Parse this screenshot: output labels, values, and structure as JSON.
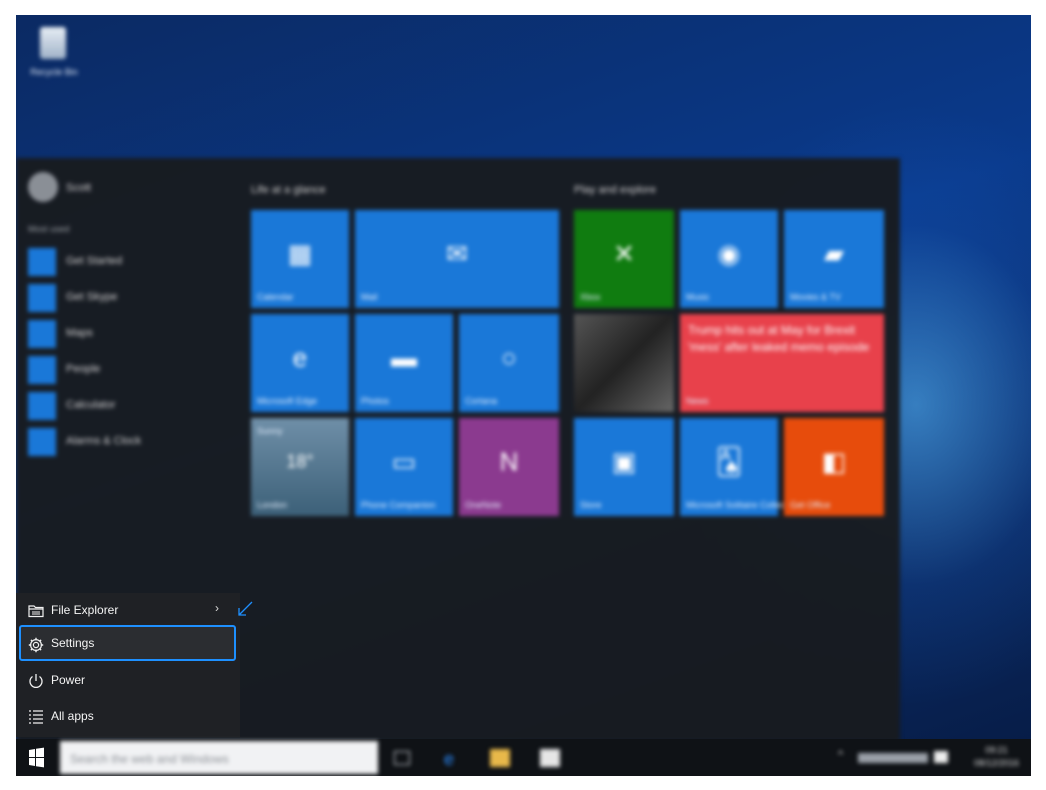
{
  "desktop": {
    "recycle_label": "Recycle Bin"
  },
  "start_menu": {
    "user_name": "Scott",
    "most_used_label": "Most used",
    "most_used": [
      {
        "label": "Get Started"
      },
      {
        "label": "Get Skype"
      },
      {
        "label": "Maps"
      },
      {
        "label": "People"
      },
      {
        "label": "Calculator"
      },
      {
        "label": "Alarms & Clock"
      }
    ],
    "group_life": "Life at a glance",
    "group_play": "Play and explore",
    "tiles": {
      "calendar": "Calendar",
      "mail": "Mail",
      "edge": "Microsoft Edge",
      "photos": "Photos",
      "cortana": "Cortana",
      "weather_top": "Sunny",
      "weather_temp": "18°",
      "weather_city": "London",
      "phone": "Phone Companion",
      "onenote": "OneNote",
      "xbox": "Xbox",
      "music": "Music",
      "movies": "Movies & TV",
      "news_headline": "Trump hits out at May for Brexit 'mess' after leaked memo episode",
      "news_label": "News",
      "store": "Store",
      "solitaire": "Microsoft Solitaire Collection",
      "office": "Get Office"
    },
    "bottom": {
      "file_explorer": "File Explorer",
      "settings": "Settings",
      "power": "Power",
      "all_apps": "All apps"
    }
  },
  "taskbar": {
    "search_placeholder": "Search the web and Windows",
    "time": "09:21",
    "date": "08/12/2016"
  },
  "colors": {
    "accent": "#1E90FF",
    "tile_blue": "#1A78D8",
    "xbox_green": "#107C10",
    "news_red": "#E8414B",
    "onenote_purple": "#8B3A8F",
    "office_orange": "#E74C0C"
  }
}
